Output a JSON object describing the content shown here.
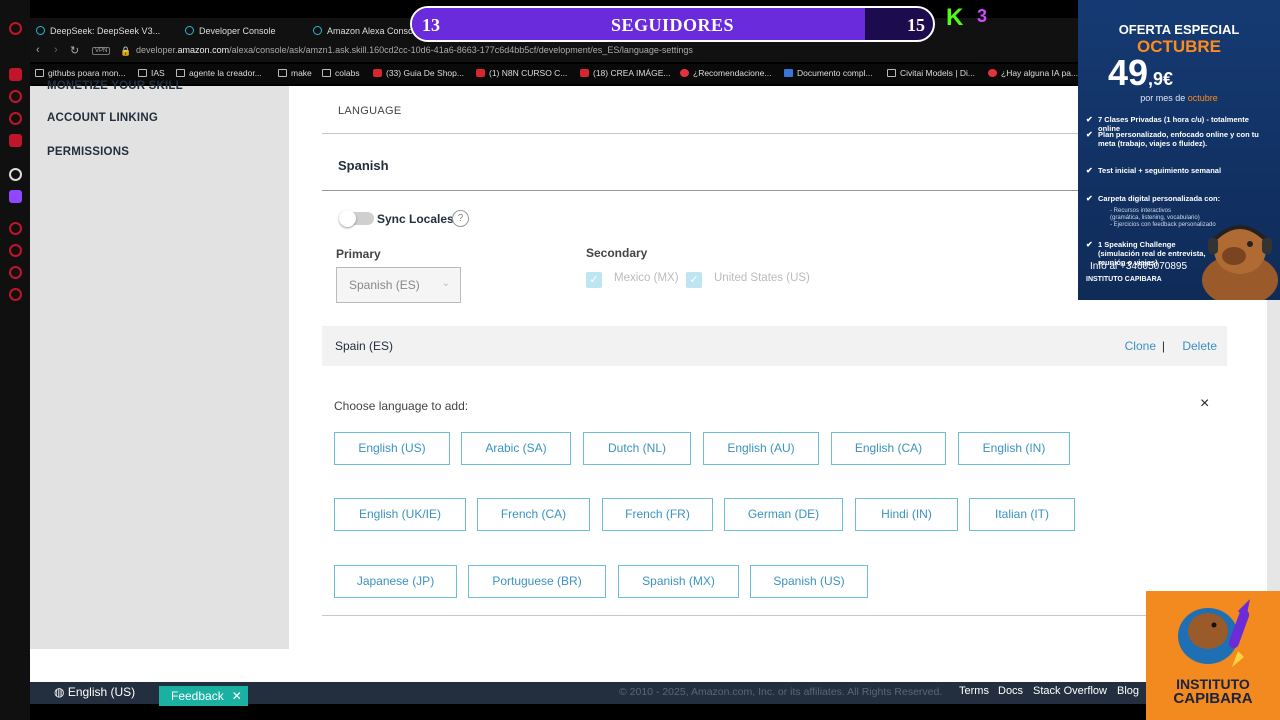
{
  "browser": {
    "tabs": [
      {
        "label": "DeepSeek: DeepSeek V3..."
      },
      {
        "label": "Developer Console"
      },
      {
        "label": "Amazon Alexa Conso"
      }
    ],
    "vpn": "VPN",
    "url_prefix": "developer.",
    "url_host": "amazon.com",
    "url_path": "/alexa/console/ask/amzn1.ask.skill.160cd2cc-10d6-41a6-8663-177c6d4bb5cf/development/es_ES/language-settings",
    "bookmarks": [
      {
        "label": "githubs poara mon...",
        "icon": "folder"
      },
      {
        "label": "IAS",
        "icon": "folder"
      },
      {
        "label": "agente la creador...",
        "icon": "folder"
      },
      {
        "label": "make",
        "icon": "folder"
      },
      {
        "label": "colabs",
        "icon": "folder"
      },
      {
        "label": "(33) Guia De Shop...",
        "icon": "youtube"
      },
      {
        "label": "(1) N8N CURSO C...",
        "icon": "youtube"
      },
      {
        "label": "(18) CREA IMÁGE...",
        "icon": "youtube"
      },
      {
        "label": "¿Recomendacione...",
        "icon": "ai"
      },
      {
        "label": "Documento compl...",
        "icon": "doc"
      },
      {
        "label": "Civitai Models | Di...",
        "icon": "folder"
      },
      {
        "label": "¿Hay alguna IA pa...",
        "icon": "ai"
      }
    ]
  },
  "sidebar": {
    "items": [
      {
        "label": "MONETIZE YOUR SKILL"
      },
      {
        "label": "ACCOUNT LINKING"
      },
      {
        "label": "PERMISSIONS"
      }
    ]
  },
  "main": {
    "language_header": "LANGUAGE",
    "locale_title": "Spanish",
    "sync_label": "Sync Locales",
    "sync_enabled": false,
    "help": "?",
    "primary_label": "Primary",
    "primary_value": "Spanish (ES)",
    "secondary_label": "Secondary",
    "secondary_options": [
      {
        "label": "Mexico (MX)",
        "checked": true
      },
      {
        "label": "United States (US)",
        "checked": true
      }
    ],
    "locale_row": {
      "name": "Spain (ES)",
      "clone": "Clone",
      "separator": "|",
      "delete": "Delete"
    },
    "choose_label": "Choose language to add:",
    "close": "×",
    "languages": [
      [
        "English (US)",
        "Arabic (SA)",
        "Dutch (NL)",
        "English (AU)",
        "English (CA)",
        "English (IN)"
      ],
      [
        "English (UK/IE)",
        "French (CA)",
        "French (FR)",
        "German (DE)",
        "Hindi (IN)",
        "Italian (IT)"
      ],
      [
        "Japanese (JP)",
        "Portuguese (BR)",
        "Spanish (MX)",
        "Spanish (US)"
      ]
    ]
  },
  "footer": {
    "language": "English (US)",
    "feedback": "Feedback",
    "copyright": "© 2010 - 2025, Amazon.com, Inc. or its affiliates. All Rights Reserved.",
    "links": [
      "Terms",
      "Docs",
      "Stack Overflow",
      "Blog"
    ]
  },
  "overlay": {
    "followers_current": "13",
    "followers_title": "SEGUIDORES",
    "followers_goal": "15",
    "followers_progress": 0.87,
    "kick_count": "3"
  },
  "ad": {
    "title": "OFERTA ESPECIAL",
    "month": "OCTUBRE",
    "price_int": "49",
    "price_dec": ",9€",
    "per_month": "por mes de",
    "per_month_hl": "octubre",
    "items": [
      "7 Clases Privadas (1 hora c/u) - totalmente online",
      "Plan personalizado, enfocado online y con tu meta (trabajo, viajes o fluidez).",
      "Test inicial + seguimiento semanal",
      "Carpeta digital personalizada con:",
      "1 Speaking Challenge (simulación real de entrevista, reunión o viajes)"
    ],
    "sub_items": [
      "- Recursos interactivos",
      "(gramática, listening, vocabulario)",
      "- Ejercicios con feedback personalizado"
    ],
    "info": "Info al +34605070895",
    "brand": "INSTITUTO CAPIBARA"
  },
  "logo": {
    "line1": "INSTITUTO",
    "line2": "CAPIBARA"
  }
}
